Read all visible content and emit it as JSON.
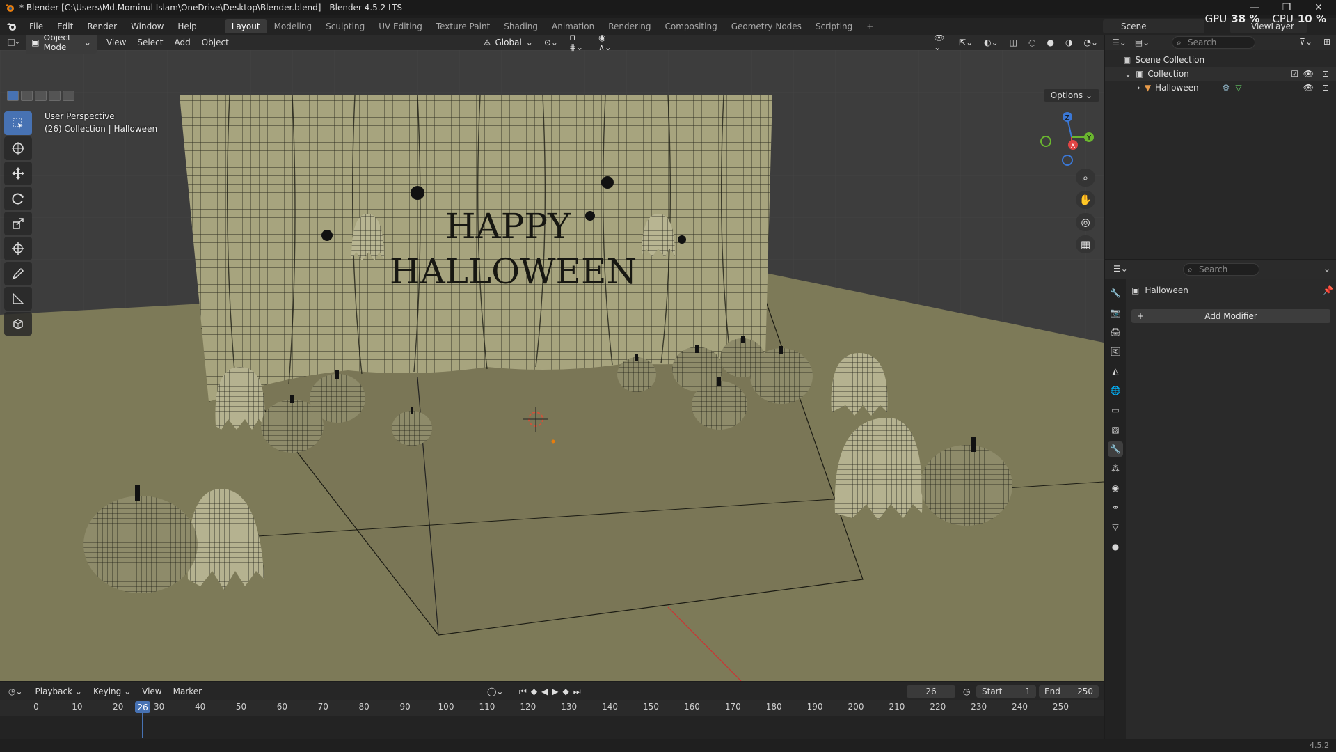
{
  "window": {
    "title": "* Blender [C:\\Users\\Md.Mominul Islam\\OneDrive\\Desktop\\Blender.blend] - Blender 4.5.2 LTS",
    "minimize": "—",
    "maximize": "❐",
    "close": "✕"
  },
  "hud": {
    "gpu_label": "GPU",
    "gpu_value": "38 %",
    "cpu_label": "CPU",
    "cpu_value": "10 %"
  },
  "menu": [
    "File",
    "Edit",
    "Render",
    "Window",
    "Help"
  ],
  "workspaces": [
    "Layout",
    "Modeling",
    "Sculpting",
    "UV Editing",
    "Texture Paint",
    "Shading",
    "Animation",
    "Rendering",
    "Compositing",
    "Geometry Nodes",
    "Scripting"
  ],
  "workspace_add": "+",
  "scene": {
    "name": "Scene",
    "view_layer": "ViewLayer"
  },
  "viewport": {
    "mode": "Object Mode",
    "menus": [
      "View",
      "Select",
      "Add",
      "Object"
    ],
    "orientation": "Global",
    "perspective": "User Perspective",
    "collection_info": "(26) Collection | Halloween",
    "options": "Options",
    "banner_line1": "HAPPY",
    "banner_line2": "HALLOWEEN",
    "gizmo": {
      "x": "X",
      "y": "Y",
      "z": "Z"
    }
  },
  "timeline": {
    "menus": [
      "Playback",
      "Keying",
      "View",
      "Marker"
    ],
    "current_frame": "26",
    "start_label": "Start",
    "start_value": "1",
    "end_label": "End",
    "end_value": "250",
    "ruler": [
      "0",
      "10",
      "20",
      "30",
      "40",
      "50",
      "60",
      "70",
      "80",
      "90",
      "100",
      "110",
      "120",
      "130",
      "140",
      "150",
      "160",
      "170",
      "180",
      "190",
      "200",
      "210",
      "220",
      "230",
      "240",
      "250"
    ]
  },
  "outliner": {
    "search_placeholder": "Search",
    "scene_collection": "Scene Collection",
    "collection": "Collection",
    "object": "Halloween"
  },
  "properties": {
    "search_placeholder": "Search",
    "object_name": "Halloween",
    "add_modifier": "Add Modifier"
  },
  "status": {
    "version": "4.5.2"
  },
  "colors": {
    "accent": "#4772b3",
    "floor": "#7d7a58",
    "curtain": "#a7a47e",
    "bg": "#3d3d3d"
  }
}
